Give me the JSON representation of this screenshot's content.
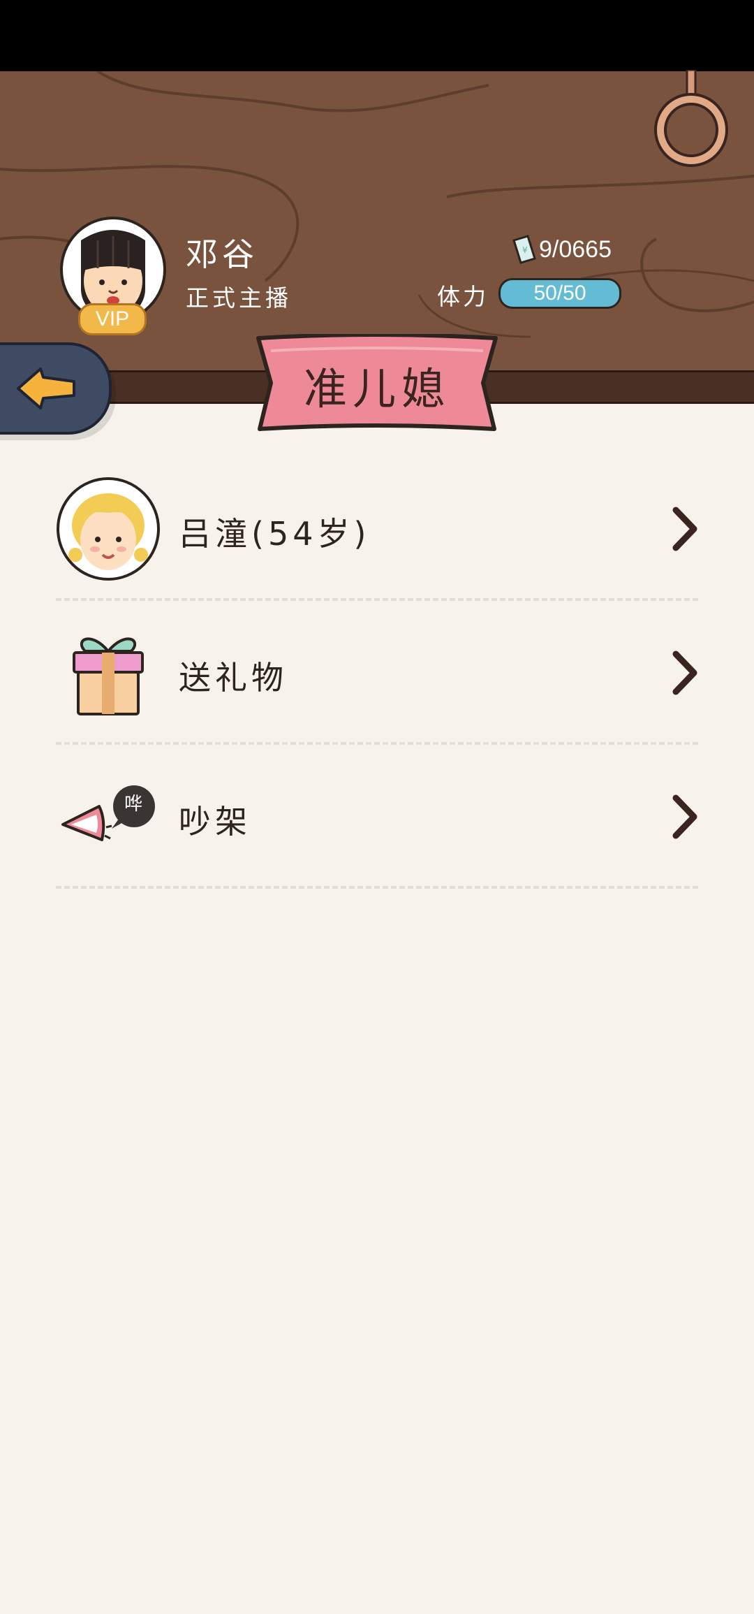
{
  "header": {
    "player_name": "邓谷",
    "player_title": "正式主播",
    "vip_badge": "VIP",
    "coins": "9/0665",
    "stamina_label": "体力",
    "stamina_value": "50/50"
  },
  "banner": {
    "title": "准儿媳"
  },
  "menu": {
    "items": [
      {
        "label": "吕潼(54岁)",
        "icon": "character-portrait-icon"
      },
      {
        "label": "送礼物",
        "icon": "gift-box-icon"
      },
      {
        "label": "吵架",
        "icon": "shouting-mouth-icon"
      }
    ]
  },
  "icons": {
    "back": "back-arrow-icon",
    "ring": "ring-icon",
    "coin": "paper-money-icon",
    "chevron": "chevron-right-icon"
  },
  "speech_bubble_text": "哗",
  "colors": {
    "header_wood": "#7a533e",
    "banner_pink": "#ee8a97",
    "stamina_blue": "#63bcd4",
    "vip_gold": "#f2b84a",
    "page_bg": "#f7f3ec",
    "back_button": "#3f4a63"
  }
}
